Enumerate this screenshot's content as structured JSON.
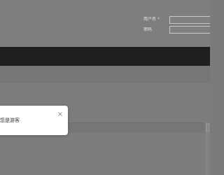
{
  "login": {
    "username_label": "用户名",
    "username_required_mark": "*",
    "username_value": "",
    "password_label": "密码",
    "password_value": ""
  },
  "dialog": {
    "message": "您是游客",
    "close_glyph": "×"
  }
}
